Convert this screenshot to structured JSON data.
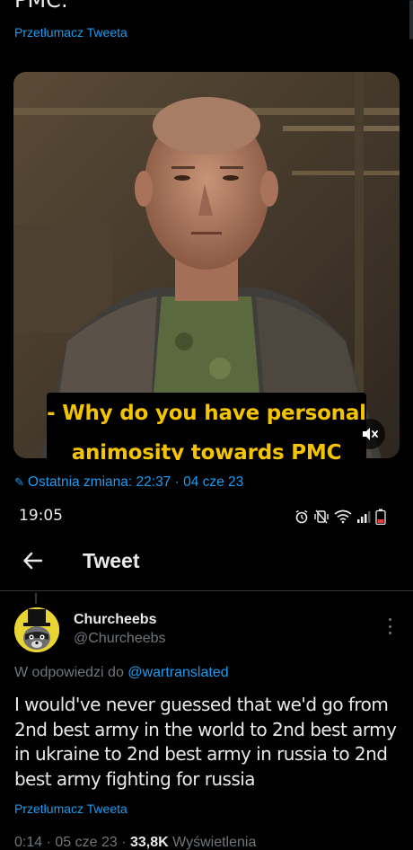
{
  "top_tweet": {
    "cut_text": "PMC.",
    "translate_label": "Przetłumacz Tweeta",
    "video": {
      "subtitle_line1": "- Why do you have personal",
      "subtitle_line2": "animosity towards PMC",
      "mute_icon": "speaker-muted-icon"
    },
    "edited_label": "Ostatnia zmiana: 22:37 · 04 cze 23"
  },
  "status_bar": {
    "time": "19:05",
    "icons": [
      "alarm-icon",
      "vibrate-mute-icon",
      "wifi-icon",
      "signal-icon",
      "battery-low-icon"
    ],
    "battery_color": "#e53935"
  },
  "header": {
    "title": "Tweet",
    "back_icon": "back-arrow-icon"
  },
  "tweet": {
    "display_name": "Churcheebs",
    "handle": "@Churcheebs",
    "reply_prefix": "W odpowiedzi do ",
    "reply_mention": "@wartranslated",
    "text": "I would've never guessed that we'd go from 2nd best army in the world to 2nd best army in ukraine to 2nd best army in russia to 2nd best army fighting for russia",
    "translate_label": "Przetłumacz Tweeta",
    "time": "0:14",
    "date": "05 cze 23",
    "views": "33,8K",
    "views_label": "Wyświetlenia"
  },
  "colors": {
    "background": "#000000",
    "text": "#e7e9ea",
    "secondary": "#71767b",
    "accent": "#1d9bf0",
    "subtitle": "#f5c400",
    "avatar_bg": "#e8d435"
  }
}
